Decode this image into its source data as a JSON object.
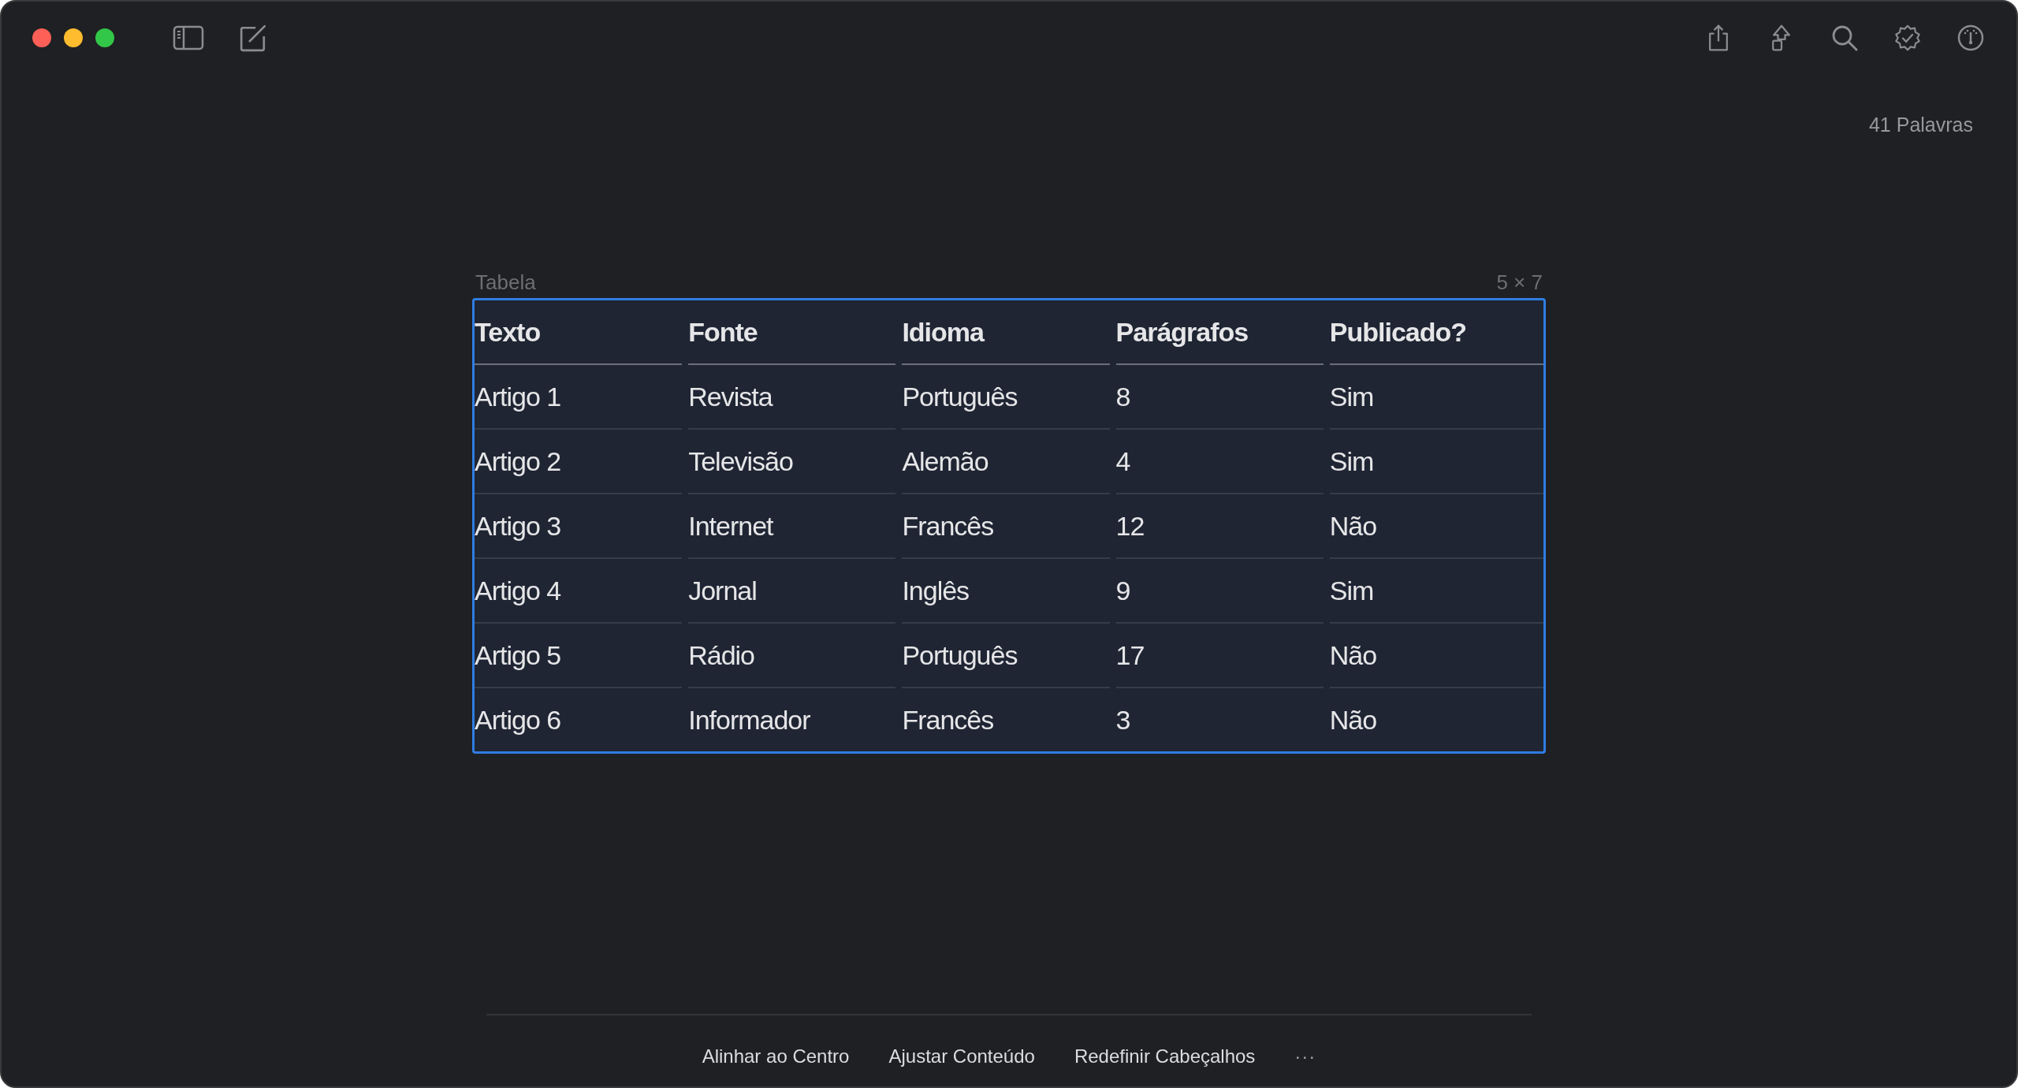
{
  "word_count": "41 Palavras",
  "table": {
    "caption": "Tabela",
    "size": "5 × 7",
    "columns": [
      "Texto",
      "Fonte",
      "Idioma",
      "Parágrafos",
      "Publicado?"
    ],
    "rows": [
      [
        "Artigo 1",
        "Revista",
        "Português",
        "8",
        "Sim"
      ],
      [
        "Artigo 2",
        "Televisão",
        "Alemão",
        "4",
        "Sim"
      ],
      [
        "Artigo 3",
        "Internet",
        "Francês",
        "12",
        "Não"
      ],
      [
        "Artigo 4",
        "Jornal",
        "Inglês",
        "9",
        "Sim"
      ],
      [
        "Artigo 5",
        "Rádio",
        "Português",
        "17",
        "Não"
      ],
      [
        "Artigo 6",
        "Informador",
        "Francês",
        "3",
        "Não"
      ]
    ]
  },
  "bottom_bar": {
    "actions": [
      "Alinhar ao Centro",
      "Ajustar Conteúdo",
      "Redefinir Cabeçalhos"
    ],
    "more": "···"
  }
}
